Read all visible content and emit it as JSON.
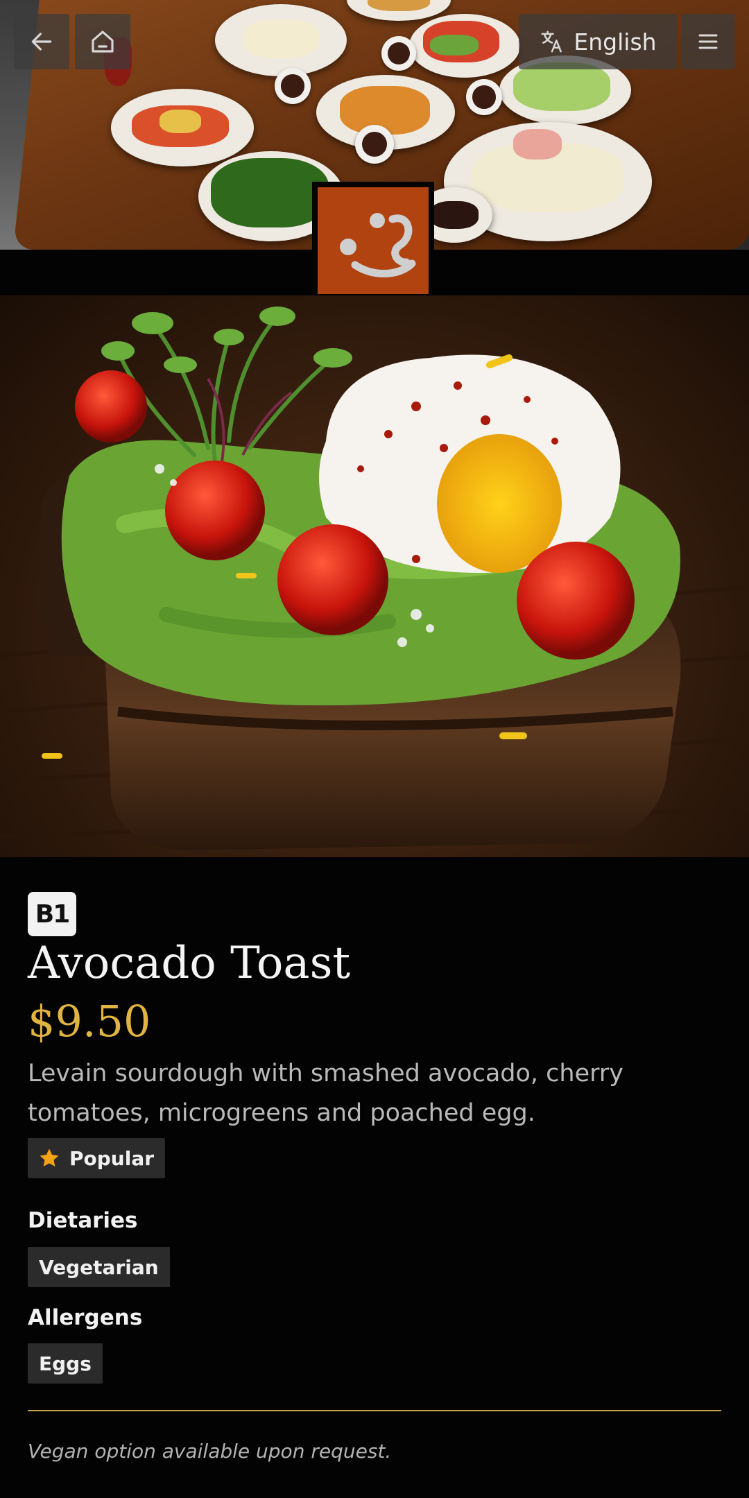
{
  "header": {
    "back_icon": "arrow-left-icon",
    "home_icon": "home-icon",
    "language_icon": "translate-icon",
    "language_label": "English",
    "menu_icon": "hamburger-menu-icon"
  },
  "logo": {
    "icon": "smiley-face-logo",
    "brand_color": "#b0430f",
    "underline_color": "#d8a21a"
  },
  "item": {
    "code": "B1",
    "name": "Avocado Toast",
    "price": "$9.50",
    "description": "Levain sourdough with smashed avocado, cherry tomatoes, microgreens and poached egg.",
    "badge": {
      "icon": "star-icon",
      "label": "Popular"
    },
    "dietaries_heading": "Dietaries",
    "dietaries": [
      "Vegetarian"
    ],
    "allergens_heading": "Allergens",
    "allergens": [
      "Eggs"
    ],
    "note": "Vegan option available upon request."
  },
  "colors": {
    "background": "#030303",
    "price": "#e1b341",
    "chip_bg": "#2b2b2b",
    "rule": "#c6a34a"
  }
}
